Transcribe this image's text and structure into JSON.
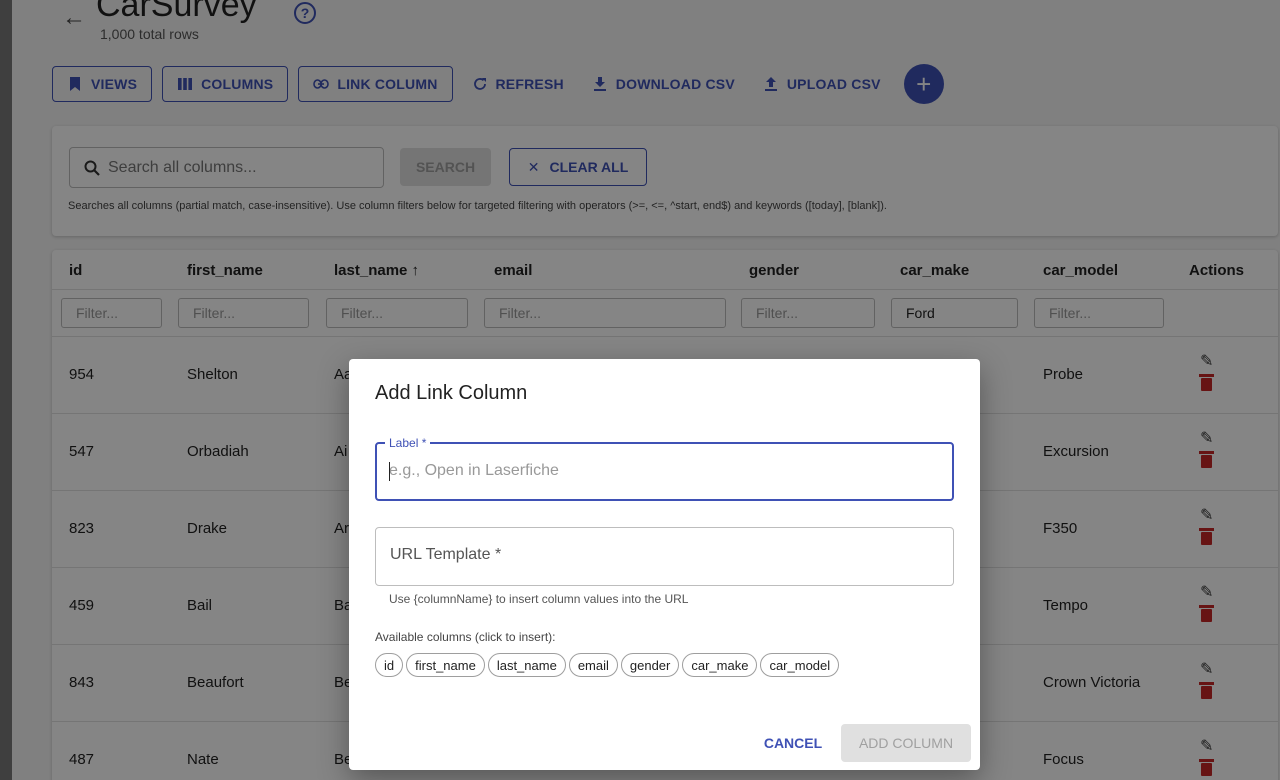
{
  "header": {
    "back_icon": "arrow-left-icon",
    "title": "CarSurvey",
    "help_icon": "help-circle-icon",
    "subtitle": "1,000 total rows"
  },
  "toolbar": {
    "views": "VIEWS",
    "columns": "COLUMNS",
    "link_column": "LINK COLUMN",
    "refresh": "REFRESH",
    "download_csv": "DOWNLOAD CSV",
    "upload_csv": "UPLOAD CSV",
    "add_icon": "+"
  },
  "search": {
    "placeholder": "Search all columns...",
    "search_button": "SEARCH",
    "clear_button": "CLEAR ALL",
    "hint": "Searches all columns (partial match, case-insensitive). Use column filters below for targeted filtering with operators (>=, <=, ^start, end$) and keywords ([today], [blank])."
  },
  "table": {
    "headers": [
      "id",
      "first_name",
      "last_name ↑",
      "email",
      "gender",
      "car_make",
      "car_model",
      "Actions"
    ],
    "filter_placeholder": "Filter...",
    "car_make_filter": "Ford",
    "rows": [
      {
        "id": "954",
        "first_name": "Shelton",
        "last_name": "Aa",
        "car_model": "Probe"
      },
      {
        "id": "547",
        "first_name": "Orbadiah",
        "last_name": "Ai",
        "car_model": "Excursion"
      },
      {
        "id": "823",
        "first_name": "Drake",
        "last_name": "Ar",
        "car_model": "F350"
      },
      {
        "id": "459",
        "first_name": "Bail",
        "last_name": "Ba",
        "car_model": "Tempo"
      },
      {
        "id": "843",
        "first_name": "Beaufort",
        "last_name": "Be",
        "car_model": "Crown Victoria"
      },
      {
        "id": "487",
        "first_name": "Nate",
        "last_name": "Be",
        "car_model": "Focus"
      }
    ]
  },
  "dialog": {
    "title": "Add Link Column",
    "label_label": "Label *",
    "label_placeholder": "e.g., Open in Laserfiche",
    "url_placeholder": "URL Template *",
    "helper": "Use {columnName} to insert column values into the URL",
    "available_label": "Available columns (click to insert):",
    "chips": [
      "id",
      "first_name",
      "last_name",
      "email",
      "gender",
      "car_make",
      "car_model"
    ],
    "cancel": "CANCEL",
    "add": "ADD COLUMN"
  },
  "colors": {
    "primary": "#3f51b5",
    "delete": "#c62828"
  }
}
